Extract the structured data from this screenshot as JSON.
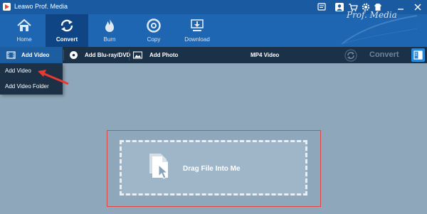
{
  "titlebar": {
    "title": "Leawo Prof. Media",
    "buttons": [
      "feedback-icon",
      "account-icon",
      "settings-icon",
      "skin-icon",
      "minimize-icon",
      "close-icon"
    ]
  },
  "nav": {
    "items": [
      {
        "label": "Home",
        "icon": "home-icon"
      },
      {
        "label": "Convert",
        "icon": "convert-icon",
        "active": true
      },
      {
        "label": "Burn",
        "icon": "burn-icon"
      },
      {
        "label": "Copy",
        "icon": "disc-icon"
      },
      {
        "label": "Download",
        "icon": "download-icon"
      }
    ],
    "brand": "Prof. Media"
  },
  "toolbar": {
    "add_video": "Add Video",
    "add_bluray": "Add Blu-ray/DVD",
    "add_photo": "Add Photo",
    "format": "MP4 Video",
    "convert": "Convert"
  },
  "dropdown": {
    "items": [
      "Add Video",
      "Add Video Folder"
    ]
  },
  "dropzone": {
    "text": "Drag File Into Me"
  },
  "colors": {
    "titlebar": "#1a5aa0",
    "navbar": "#1e66b1",
    "nav_active": "#0f4585",
    "toolbar": "#1b3148",
    "background": "#8fa7ba",
    "annotation": "#e04848"
  }
}
